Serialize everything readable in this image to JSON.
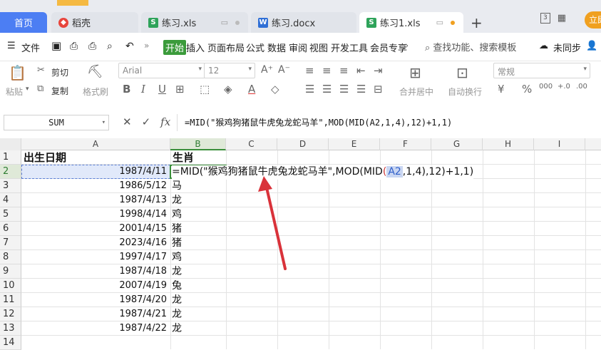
{
  "tabs": {
    "home": "首页",
    "daoke": "稻壳",
    "lianxi_xls": "练习.xls",
    "lianxi_docx": "练习.docx",
    "lianxi1_xls": "练习1.xls",
    "login": "立即"
  },
  "menu": {
    "file": "文件",
    "start": "开始",
    "insert": "插入",
    "layout": "页面布局",
    "formula": "公式",
    "data": "数据",
    "review": "审阅",
    "view": "视图",
    "dev": "开发工具",
    "member": "会员专享",
    "search": "查找功能、搜索模板",
    "sync": "未同步"
  },
  "ribbon": {
    "paste": "粘贴",
    "cut": "剪切",
    "copy": "复制",
    "format_painter": "格式刷",
    "font": "Arial",
    "font_size": "12",
    "number_format": "常规",
    "merge": "合并居中",
    "wrap": "自动换行"
  },
  "formula_bar": {
    "name_box": "SUM",
    "fx": "fx",
    "formula": "=MID(\"猴鸡狗猪鼠牛虎兔龙蛇马羊\",MOD(MID(A2,1,4),12)+1,1)"
  },
  "sheet": {
    "columns": [
      "A",
      "B",
      "C",
      "D",
      "E",
      "F",
      "G",
      "H",
      "I"
    ],
    "row_numbers": [
      "1",
      "2",
      "3",
      "4",
      "5",
      "6",
      "7",
      "8",
      "9",
      "10",
      "11",
      "12",
      "13",
      "14"
    ],
    "header_a": "出生日期",
    "header_b": "生肖",
    "dates": [
      "1987/4/11",
      "1986/5/12",
      "1987/4/13",
      "1998/4/14",
      "2001/4/15",
      "2023/4/16",
      "1997/4/17",
      "1987/4/18",
      "2007/4/19",
      "1987/4/20",
      "1987/4/21",
      "1987/4/22"
    ],
    "zodiac": [
      "",
      "马",
      "龙",
      "鸡",
      "猪",
      "猪",
      "鸡",
      "龙",
      "兔",
      "龙",
      "龙",
      "龙"
    ],
    "edit_parts": {
      "p1": "=MID(\"猴鸡狗猪鼠牛虎兔龙蛇马羊\",MOD(MID",
      "p2": "(",
      "ref": "A2",
      "p3": ",1,4)",
      "p4": ",12)+1,1)"
    }
  },
  "colors": {
    "accent_blue": "#4c7ef3",
    "accent_green": "#3a8f3a",
    "arrow_red": "#d9323a"
  }
}
